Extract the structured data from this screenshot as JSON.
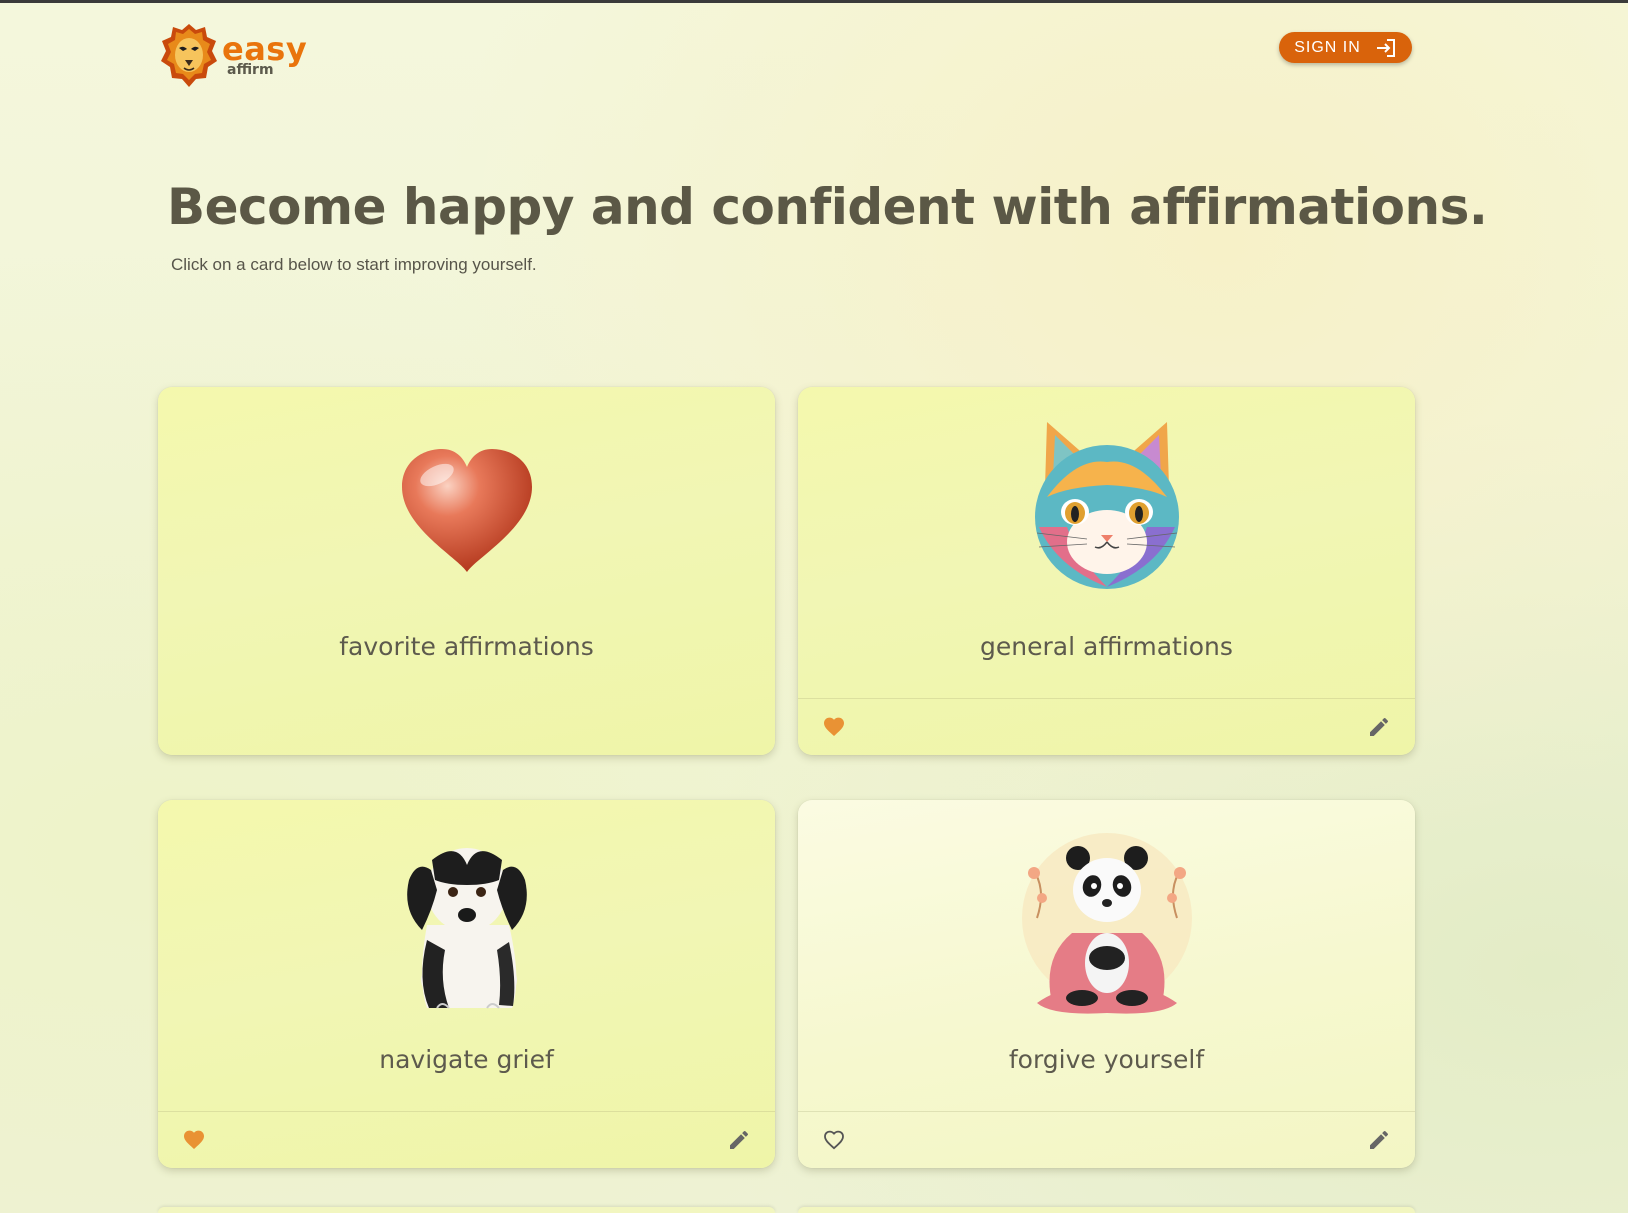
{
  "brand": {
    "name_primary": "easy",
    "name_secondary": "affirm",
    "accent": "#e9740c"
  },
  "header": {
    "signin_label": "SIGN IN",
    "signin_icon": "login-icon"
  },
  "hero": {
    "title": "Become happy and confident with affirmations.",
    "subtitle": "Click on a card below to start improving yourself."
  },
  "cards": [
    {
      "label": "favorite affirmations",
      "image": "heart-image",
      "has_footer": false
    },
    {
      "label": "general affirmations",
      "image": "cat-image",
      "has_footer": true,
      "favorited": true
    },
    {
      "label": "navigate grief",
      "image": "puppy-image",
      "has_footer": true,
      "favorited": true
    },
    {
      "label": "forgive yourself",
      "image": "panda-image",
      "has_footer": true,
      "favorited": false
    }
  ],
  "colors": {
    "signin_bg": "#d9630b",
    "favorite_heart": "#e99234",
    "text": "#5b5846"
  }
}
